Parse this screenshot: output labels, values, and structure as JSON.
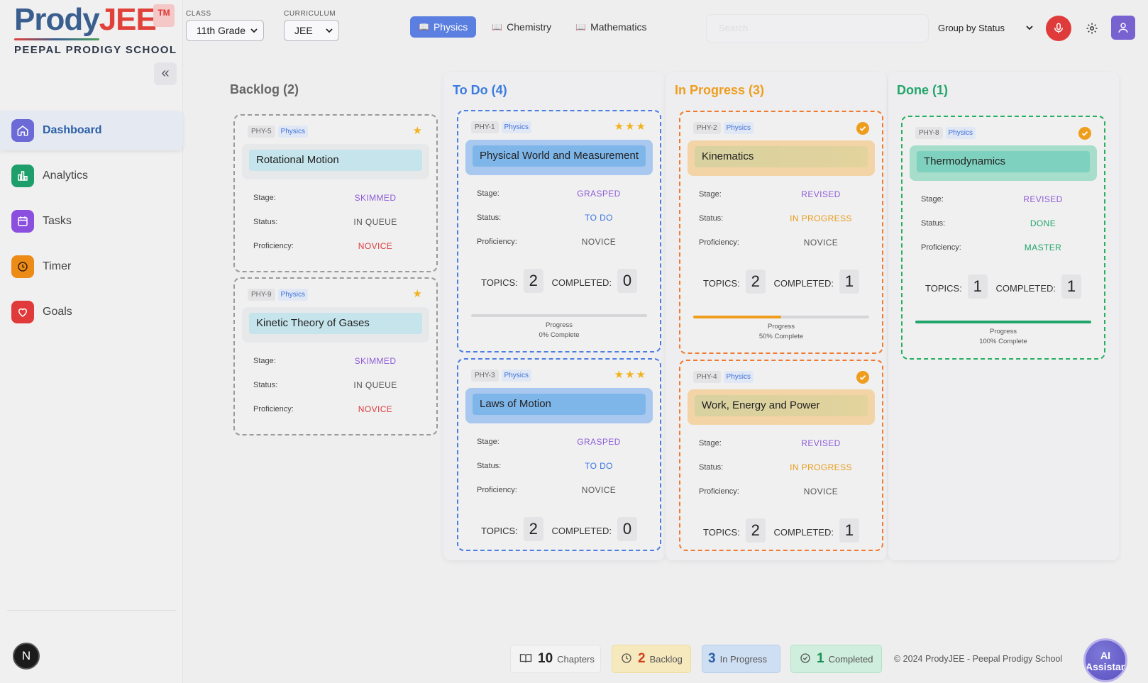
{
  "brand": {
    "prody": "Prody",
    "jee": "JEE",
    "tm": "TM",
    "school": "PEEPAL PRODIGY SCHOOL"
  },
  "sidebar": {
    "collapse_icon": "double-chevron-left-icon",
    "items": [
      {
        "label": "Dashboard",
        "icon": "home-icon",
        "color": "#6b6ad6",
        "active": true
      },
      {
        "label": "Analytics",
        "icon": "bar-chart-icon",
        "color": "#1d9e6a"
      },
      {
        "label": "Tasks",
        "icon": "calendar-icon",
        "color": "#8b4fe0"
      },
      {
        "label": "Timer",
        "icon": "clock-icon",
        "color": "#ec8b16"
      },
      {
        "label": "Goals",
        "icon": "heart-icon",
        "color": "#e03a3a"
      }
    ],
    "avatar_letter": "N"
  },
  "header": {
    "class_label": "CLASS",
    "class_value": "11th Grade",
    "curriculum_label": "CURRICULUM",
    "curriculum_value": "JEE",
    "subjects": [
      "Physics",
      "Chemistry",
      "Mathematics"
    ],
    "active_subject": "Physics",
    "search_placeholder": "Search",
    "group_by": "Group by Status"
  },
  "board": {
    "columns": [
      {
        "title": "Backlog (2)",
        "color": "#666"
      },
      {
        "title": "To Do (4)",
        "color": "#3b7be0"
      },
      {
        "title": "In Progress (3)",
        "color": "#ef9d1d"
      },
      {
        "title": "Done (1)",
        "color": "#22a56b"
      }
    ],
    "labels": {
      "stage": "Stage:",
      "status": "Status:",
      "proficiency": "Proficiency:",
      "topics": "TOPICS:",
      "completed": "COMPLETED:",
      "progress": "Progress"
    },
    "cards": [
      {
        "id": "PHY-5",
        "subject": "Physics",
        "title": "Rotational Motion",
        "stars": "★",
        "stage": "SKIMMED",
        "status": "IN QUEUE",
        "proficiency": "NOVICE"
      },
      {
        "id": "PHY-9",
        "subject": "Physics",
        "title": "Kinetic Theory of Gases",
        "stars": "★",
        "stage": "SKIMMED",
        "status": "IN QUEUE",
        "proficiency": "NOVICE"
      },
      {
        "id": "PHY-1",
        "subject": "Physics",
        "title": "Physical World and Measurement",
        "stars": "★★★",
        "stage": "GRASPED",
        "status": "TO DO",
        "proficiency": "NOVICE",
        "topics": "2",
        "completed": "0",
        "progress_text": "0% Complete",
        "progress": 0
      },
      {
        "id": "PHY-3",
        "subject": "Physics",
        "title": "Laws of Motion",
        "stars": "★★★",
        "stage": "GRASPED",
        "status": "TO DO",
        "proficiency": "NOVICE",
        "topics": "2",
        "completed": "0"
      },
      {
        "id": "PHY-2",
        "subject": "Physics",
        "title": "Kinematics",
        "stage": "REVISED",
        "status": "IN PROGRESS",
        "proficiency": "NOVICE",
        "topics": "2",
        "completed": "1",
        "progress_text": "50% Complete",
        "progress": 0.5
      },
      {
        "id": "PHY-4",
        "subject": "Physics",
        "title": "Work, Energy and Power",
        "stage": "REVISED",
        "status": "IN PROGRESS",
        "proficiency": "NOVICE",
        "topics": "2",
        "completed": "1"
      },
      {
        "id": "PHY-8",
        "subject": "Physics",
        "title": "Thermodynamics",
        "stage": "REVISED",
        "status": "DONE",
        "proficiency": "MASTER",
        "topics": "1",
        "completed": "1",
        "progress_text": "100% Complete",
        "progress": 1
      }
    ]
  },
  "footer": {
    "chapters": {
      "n": "10",
      "label": "Chapters"
    },
    "backlog": {
      "n": "2",
      "label": "Backlog"
    },
    "in_progress": {
      "n": "3",
      "label": "In Progress"
    },
    "completed": {
      "n": "1",
      "label": "Completed"
    },
    "copyright": "© 2024 ProdyJEE - Peepal Prodigy School",
    "ai_button": "AI Assistant"
  }
}
